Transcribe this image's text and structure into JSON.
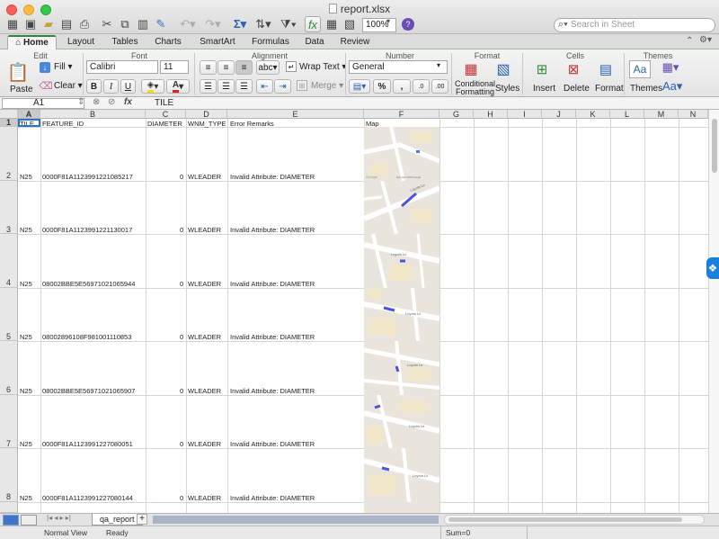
{
  "window": {
    "title": "report.xlsx",
    "zoom": "100%",
    "search_placeholder": "Search in Sheet"
  },
  "ribbon_tabs": [
    "Home",
    "Layout",
    "Tables",
    "Charts",
    "SmartArt",
    "Formulas",
    "Data",
    "Review"
  ],
  "groups": {
    "edit": "Edit",
    "font": "Font",
    "alignment": "Alignment",
    "number": "Number",
    "format": "Format",
    "cells": "Cells",
    "themes": "Themes"
  },
  "edit": {
    "paste": "Paste",
    "fill": "Fill",
    "clear": "Clear"
  },
  "font": {
    "name": "Calibri",
    "size": "11",
    "bold": "B",
    "italic": "I",
    "underline": "U"
  },
  "alignment": {
    "abc": "abc",
    "wrap": "Wrap Text",
    "merge": "Merge"
  },
  "number": {
    "format": "General",
    "percent": "%",
    "comma": ","
  },
  "format_group": {
    "conditional_1": "Conditional",
    "conditional_2": "Formatting",
    "styles": "Styles"
  },
  "cells_group": {
    "insert": "Insert",
    "delete": "Delete",
    "format": "Format"
  },
  "themes_group": {
    "themes": "Themes",
    "aa": "Aa"
  },
  "formula_bar": {
    "cell_ref": "A1",
    "fx": "fx",
    "value": "TILE"
  },
  "columns": [
    "A",
    "B",
    "C",
    "D",
    "E",
    "F",
    "G",
    "H",
    "I",
    "J",
    "K",
    "L",
    "M",
    "N"
  ],
  "headers": {
    "tile": "TILE",
    "feature_id": "FEATURE_ID",
    "diameter": "DIAMETER",
    "wnm_type": "WNM_TYPE",
    "error_remarks": "Error Remarks",
    "map": "Map"
  },
  "rows": [
    {
      "num": "1"
    },
    {
      "num": "2",
      "tile": "N25",
      "feature_id": "0000F81A1123991221085217",
      "diameter": "0",
      "wnm_type": "WLEADER",
      "error": "Invalid Attribute: DIAMETER"
    },
    {
      "num": "3",
      "tile": "N25",
      "feature_id": "0000F81A1123991221130017",
      "diameter": "0",
      "wnm_type": "WLEADER",
      "error": "Invalid Attribute: DIAMETER"
    },
    {
      "num": "4",
      "tile": "N25",
      "feature_id": "08002BBE5E56971021065944",
      "diameter": "0",
      "wnm_type": "WLEADER",
      "error": "Invalid Attribute: DIAMETER"
    },
    {
      "num": "5",
      "tile": "N25",
      "feature_id": "08002896108F981001110853",
      "diameter": "0",
      "wnm_type": "WLEADER",
      "error": "Invalid Attribute: DIAMETER"
    },
    {
      "num": "6",
      "tile": "N25",
      "feature_id": "08002BBE5E56971021065907",
      "diameter": "0",
      "wnm_type": "WLEADER",
      "error": "Invalid Attribute: DIAMETER"
    },
    {
      "num": "7",
      "tile": "N25",
      "feature_id": "0000F81A1123991227080051",
      "diameter": "0",
      "wnm_type": "WLEADER",
      "error": "Invalid Attribute: DIAMETER"
    },
    {
      "num": "8",
      "tile": "N25",
      "feature_id": "0000F81A1123991227080144",
      "diameter": "0",
      "wnm_type": "WLEADER",
      "error": "Invalid Attribute: DIAMETER"
    }
  ],
  "map_labels": {
    "google": "Google",
    "data": "Map data ©2015 Google",
    "street": "Loyola Ln"
  },
  "sheet_tab": "qa_report",
  "status": {
    "view": "Normal View",
    "ready": "Ready",
    "sum": "Sum=0"
  }
}
